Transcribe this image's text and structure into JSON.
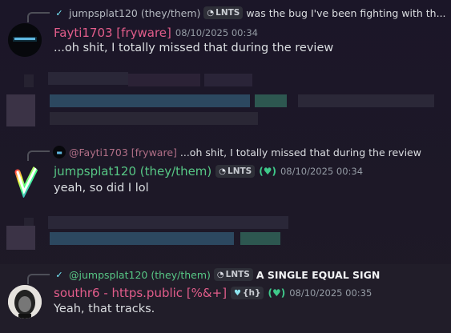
{
  "messages": [
    {
      "reply": {
        "name": "jumpsplat120 (they/them)",
        "tag": "LNTS",
        "text": "was the bug I've been fighting with th..."
      },
      "username": "Fayti1703 [fryware]",
      "timestamp": "08/10/2025 00:34",
      "text": "...oh shit, I totally missed that during the review",
      "colors": {
        "username": "#e35d8b"
      }
    },
    {
      "reply": {
        "name": "@Fayti1703 [fryware]",
        "text": "...oh shit, I totally missed that during the review"
      },
      "username": "jumpsplat120 (they/them)",
      "tag": "LNTS",
      "timestamp": "08/10/2025 00:34",
      "text": "yeah, so did I lol",
      "colors": {
        "username": "#57c785"
      }
    },
    {
      "reply": {
        "name": "@jumpsplat120 (they/them)",
        "tag": "LNTS",
        "text": "A SINGLE EQUAL SIGN"
      },
      "username": "southr6 - https.public [%&+]",
      "tag": "{h}",
      "timestamp": "08/10/2025 00:35",
      "text": "Yeah, that tracks.",
      "colors": {
        "username": "#e35d8b"
      }
    }
  ],
  "icons": {
    "tag_icon": "clan-badge-icon",
    "role_icon": "role-icon"
  }
}
